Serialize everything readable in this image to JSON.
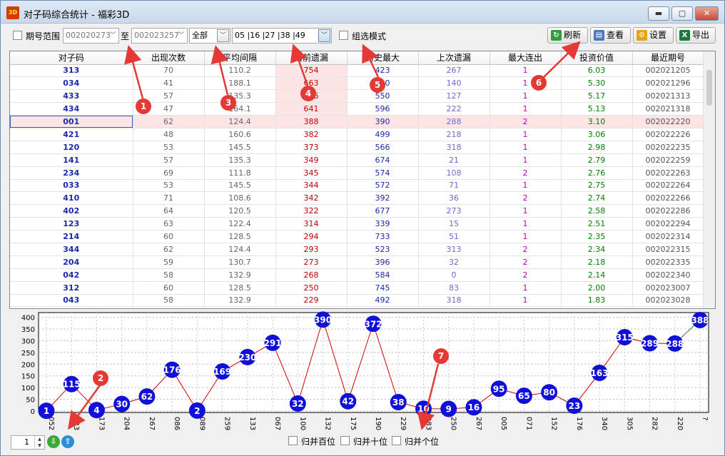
{
  "window": {
    "title": "对子码综合统计 - 福彩3D",
    "app_icon_label": "3D",
    "minimize": "▬",
    "maximize": "▢",
    "close": "✕"
  },
  "toolbar": {
    "period_range_label": "期号范围",
    "period_from": "002020273",
    "to_label": "至",
    "period_to": "002023257",
    "filter_value": "全部",
    "numbers_value": "05 |16 |27 |38 |49",
    "group_mode_label": "组选模式",
    "refresh_label": "刷新",
    "view_label": "查看",
    "settings_label": "设置",
    "export_label": "导出"
  },
  "table": {
    "columns": [
      "对子码",
      "出现次数",
      "平均间隔",
      "当前遗漏",
      "历史最大",
      "上次遗漏",
      "最大连出",
      "投资价值",
      "最近期号"
    ],
    "rows": [
      [
        "313",
        "70",
        "110.2",
        "754",
        "423",
        "267",
        "1",
        "6.03",
        "002021205"
      ],
      [
        "034",
        "41",
        "188.1",
        "663",
        "710",
        "140",
        "1",
        "5.30",
        "002021296"
      ],
      [
        "433",
        "57",
        "135.3",
        "646",
        "550",
        "127",
        "1",
        "5.17",
        "002021313"
      ],
      [
        "434",
        "47",
        "164.1",
        "641",
        "596",
        "222",
        "1",
        "5.13",
        "002021318"
      ],
      [
        "001",
        "62",
        "124.4",
        "388",
        "390",
        "288",
        "2",
        "3.10",
        "002022220"
      ],
      [
        "421",
        "48",
        "160.6",
        "382",
        "499",
        "218",
        "1",
        "3.06",
        "002022226"
      ],
      [
        "120",
        "53",
        "145.5",
        "373",
        "566",
        "318",
        "1",
        "2.98",
        "002022235"
      ],
      [
        "141",
        "57",
        "135.3",
        "349",
        "674",
        "21",
        "1",
        "2.79",
        "002022259"
      ],
      [
        "234",
        "69",
        "111.8",
        "345",
        "574",
        "108",
        "2",
        "2.76",
        "002022263"
      ],
      [
        "033",
        "53",
        "145.5",
        "344",
        "572",
        "71",
        "1",
        "2.75",
        "002022264"
      ],
      [
        "410",
        "71",
        "108.6",
        "342",
        "392",
        "36",
        "2",
        "2.74",
        "002022266"
      ],
      [
        "402",
        "64",
        "120.5",
        "322",
        "677",
        "273",
        "1",
        "2.58",
        "002022286"
      ],
      [
        "123",
        "63",
        "122.4",
        "314",
        "339",
        "15",
        "1",
        "2.51",
        "002022294"
      ],
      [
        "214",
        "60",
        "128.5",
        "294",
        "733",
        "51",
        "1",
        "2.35",
        "002022314"
      ],
      [
        "344",
        "62",
        "124.4",
        "293",
        "523",
        "313",
        "2",
        "2.34",
        "002022315"
      ],
      [
        "204",
        "59",
        "130.7",
        "273",
        "396",
        "32",
        "2",
        "2.18",
        "002022335"
      ],
      [
        "042",
        "58",
        "132.9",
        "268",
        "584",
        "0",
        "2",
        "2.14",
        "002022340"
      ],
      [
        "312",
        "60",
        "128.5",
        "250",
        "745",
        "83",
        "1",
        "2.00",
        "002023007"
      ],
      [
        "043",
        "58",
        "132.9",
        "229",
        "492",
        "318",
        "1",
        "1.83",
        "002023028"
      ]
    ]
  },
  "callouts": [
    "1",
    "2",
    "3",
    "4",
    "5",
    "6",
    "7"
  ],
  "chart_data": {
    "type": "line",
    "y_ticks": [
      "400",
      "350",
      "300",
      "250",
      "200",
      "150",
      "100",
      "50",
      "0"
    ],
    "ylim": [
      0,
      420
    ],
    "x": [
      "052",
      "083",
      "173",
      "204",
      "267",
      "086",
      "089",
      "259",
      "133",
      "067",
      "100",
      "132",
      "175",
      "190",
      "229",
      "283",
      "250",
      "267",
      "005",
      "071",
      "152",
      "176",
      "340",
      "305",
      "282",
      "220",
      "?"
    ],
    "values": [
      1,
      115,
      4,
      30,
      62,
      176,
      2,
      169,
      230,
      291,
      32,
      390,
      42,
      372,
      38,
      10,
      9,
      16,
      95,
      65,
      80,
      23,
      163,
      315,
      289,
      288,
      388
    ],
    "colors": {
      "marker": "#1010d8",
      "line": "#d00000",
      "last_segment": "#2a8a2a",
      "label": "#ffffff"
    }
  },
  "footer": {
    "page_value": "1",
    "merge_hundreds": "归并百位",
    "merge_tens": "归并十位",
    "merge_units": "归并个位"
  }
}
